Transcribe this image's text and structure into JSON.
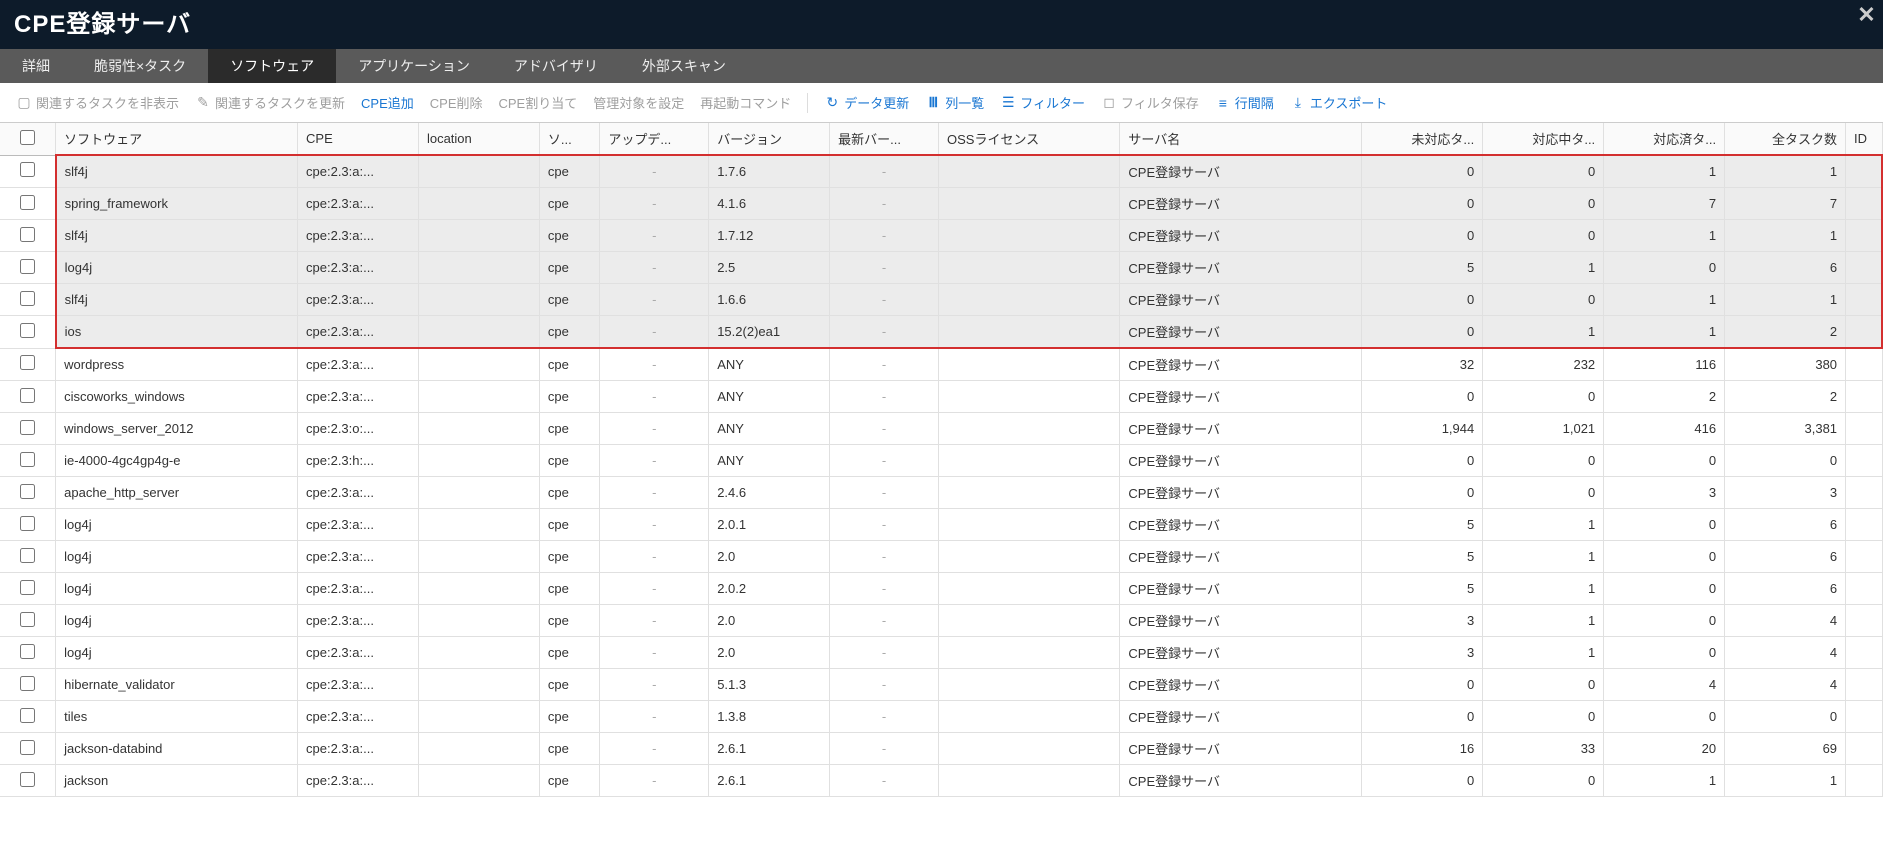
{
  "title": "CPE登録サーバ",
  "tabs": [
    {
      "label": "詳細",
      "active": false
    },
    {
      "label": "脆弱性×タスク",
      "active": false
    },
    {
      "label": "ソフトウェア",
      "active": true
    },
    {
      "label": "アプリケーション",
      "active": false
    },
    {
      "label": "アドバイザリ",
      "active": false
    },
    {
      "label": "外部スキャン",
      "active": false
    }
  ],
  "toolbar": {
    "hide_tasks": "関連するタスクを非表示",
    "update_tasks": "関連するタスクを更新",
    "cpe_add": "CPE追加",
    "cpe_delete": "CPE削除",
    "cpe_assign": "CPE割り当て",
    "set_target": "管理対象を設定",
    "restart_cmd": "再起動コマンド",
    "refresh": "データ更新",
    "columns": "列一覧",
    "filter": "フィルター",
    "save_filter": "フィルタ保存",
    "row_spacing": "行間隔",
    "export": "エクスポート"
  },
  "columns": {
    "software": "ソフトウェア",
    "cpe": "CPE",
    "location": "location",
    "source": "ソ...",
    "update": "アップデ...",
    "version": "バージョン",
    "latest": "最新バー...",
    "oss": "OSSライセンス",
    "server": "サーバ名",
    "unhandled": "未対応タ...",
    "inprogress": "対応中タ...",
    "done": "対応済タ...",
    "total": "全タスク数",
    "id": "ID"
  },
  "rows": [
    {
      "hl": true,
      "software": "slf4j",
      "cpe": "cpe:2.3:a:...",
      "location": "",
      "source": "cpe",
      "update": "-",
      "version": "1.7.6",
      "latest": "-",
      "oss": "",
      "server": "CPE登録サーバ",
      "unhandled": "0",
      "inprogress": "0",
      "done": "1",
      "total": "1"
    },
    {
      "hl": true,
      "software": "spring_framework",
      "cpe": "cpe:2.3:a:...",
      "location": "",
      "source": "cpe",
      "update": "-",
      "version": "4.1.6",
      "latest": "-",
      "oss": "",
      "server": "CPE登録サーバ",
      "unhandled": "0",
      "inprogress": "0",
      "done": "7",
      "total": "7"
    },
    {
      "hl": true,
      "software": "slf4j",
      "cpe": "cpe:2.3:a:...",
      "location": "",
      "source": "cpe",
      "update": "-",
      "version": "1.7.12",
      "latest": "-",
      "oss": "",
      "server": "CPE登録サーバ",
      "unhandled": "0",
      "inprogress": "0",
      "done": "1",
      "total": "1"
    },
    {
      "hl": true,
      "software": "log4j",
      "cpe": "cpe:2.3:a:...",
      "location": "",
      "source": "cpe",
      "update": "-",
      "version": "2.5",
      "latest": "-",
      "oss": "",
      "server": "CPE登録サーバ",
      "unhandled": "5",
      "inprogress": "1",
      "done": "0",
      "total": "6"
    },
    {
      "hl": true,
      "software": "slf4j",
      "cpe": "cpe:2.3:a:...",
      "location": "",
      "source": "cpe",
      "update": "-",
      "version": "1.6.6",
      "latest": "-",
      "oss": "",
      "server": "CPE登録サーバ",
      "unhandled": "0",
      "inprogress": "0",
      "done": "1",
      "total": "1"
    },
    {
      "hl": true,
      "software": "ios",
      "cpe": "cpe:2.3:a:...",
      "location": "",
      "source": "cpe",
      "update": "-",
      "version": "15.2(2)ea1",
      "latest": "-",
      "oss": "",
      "server": "CPE登録サーバ",
      "unhandled": "0",
      "inprogress": "1",
      "done": "1",
      "total": "2"
    },
    {
      "hl": false,
      "software": "wordpress",
      "cpe": "cpe:2.3:a:...",
      "location": "",
      "source": "cpe",
      "update": "-",
      "version": "ANY",
      "latest": "-",
      "oss": "",
      "server": "CPE登録サーバ",
      "unhandled": "32",
      "inprogress": "232",
      "done": "116",
      "total": "380"
    },
    {
      "hl": false,
      "software": "ciscoworks_windows",
      "cpe": "cpe:2.3:a:...",
      "location": "",
      "source": "cpe",
      "update": "-",
      "version": "ANY",
      "latest": "-",
      "oss": "",
      "server": "CPE登録サーバ",
      "unhandled": "0",
      "inprogress": "0",
      "done": "2",
      "total": "2"
    },
    {
      "hl": false,
      "software": "windows_server_2012",
      "cpe": "cpe:2.3:o:...",
      "location": "",
      "source": "cpe",
      "update": "-",
      "version": "ANY",
      "latest": "-",
      "oss": "",
      "server": "CPE登録サーバ",
      "unhandled": "1,944",
      "inprogress": "1,021",
      "done": "416",
      "total": "3,381"
    },
    {
      "hl": false,
      "software": "ie-4000-4gc4gp4g-e",
      "cpe": "cpe:2.3:h:...",
      "location": "",
      "source": "cpe",
      "update": "-",
      "version": "ANY",
      "latest": "-",
      "oss": "",
      "server": "CPE登録サーバ",
      "unhandled": "0",
      "inprogress": "0",
      "done": "0",
      "total": "0"
    },
    {
      "hl": false,
      "software": "apache_http_server",
      "cpe": "cpe:2.3:a:...",
      "location": "",
      "source": "cpe",
      "update": "-",
      "version": "2.4.6",
      "latest": "-",
      "oss": "",
      "server": "CPE登録サーバ",
      "unhandled": "0",
      "inprogress": "0",
      "done": "3",
      "total": "3"
    },
    {
      "hl": false,
      "software": "log4j",
      "cpe": "cpe:2.3:a:...",
      "location": "",
      "source": "cpe",
      "update": "-",
      "version": "2.0.1",
      "latest": "-",
      "oss": "",
      "server": "CPE登録サーバ",
      "unhandled": "5",
      "inprogress": "1",
      "done": "0",
      "total": "6"
    },
    {
      "hl": false,
      "software": "log4j",
      "cpe": "cpe:2.3:a:...",
      "location": "",
      "source": "cpe",
      "update": "-",
      "version": "2.0",
      "latest": "-",
      "oss": "",
      "server": "CPE登録サーバ",
      "unhandled": "5",
      "inprogress": "1",
      "done": "0",
      "total": "6"
    },
    {
      "hl": false,
      "software": "log4j",
      "cpe": "cpe:2.3:a:...",
      "location": "",
      "source": "cpe",
      "update": "-",
      "version": "2.0.2",
      "latest": "-",
      "oss": "",
      "server": "CPE登録サーバ",
      "unhandled": "5",
      "inprogress": "1",
      "done": "0",
      "total": "6"
    },
    {
      "hl": false,
      "software": "log4j",
      "cpe": "cpe:2.3:a:...",
      "location": "",
      "source": "cpe",
      "update": "-",
      "version": "2.0",
      "latest": "-",
      "oss": "",
      "server": "CPE登録サーバ",
      "unhandled": "3",
      "inprogress": "1",
      "done": "0",
      "total": "4"
    },
    {
      "hl": false,
      "software": "log4j",
      "cpe": "cpe:2.3:a:...",
      "location": "",
      "source": "cpe",
      "update": "-",
      "version": "2.0",
      "latest": "-",
      "oss": "",
      "server": "CPE登録サーバ",
      "unhandled": "3",
      "inprogress": "1",
      "done": "0",
      "total": "4"
    },
    {
      "hl": false,
      "software": "hibernate_validator",
      "cpe": "cpe:2.3:a:...",
      "location": "",
      "source": "cpe",
      "update": "-",
      "version": "5.1.3",
      "latest": "-",
      "oss": "",
      "server": "CPE登録サーバ",
      "unhandled": "0",
      "inprogress": "0",
      "done": "4",
      "total": "4"
    },
    {
      "hl": false,
      "software": "tiles",
      "cpe": "cpe:2.3:a:...",
      "location": "",
      "source": "cpe",
      "update": "-",
      "version": "1.3.8",
      "latest": "-",
      "oss": "",
      "server": "CPE登録サーバ",
      "unhandled": "0",
      "inprogress": "0",
      "done": "0",
      "total": "0"
    },
    {
      "hl": false,
      "software": "jackson-databind",
      "cpe": "cpe:2.3:a:...",
      "location": "",
      "source": "cpe",
      "update": "-",
      "version": "2.6.1",
      "latest": "-",
      "oss": "",
      "server": "CPE登録サーバ",
      "unhandled": "16",
      "inprogress": "33",
      "done": "20",
      "total": "69"
    },
    {
      "hl": false,
      "software": "jackson",
      "cpe": "cpe:2.3:a:...",
      "location": "",
      "source": "cpe",
      "update": "-",
      "version": "2.6.1",
      "latest": "-",
      "oss": "",
      "server": "CPE登録サーバ",
      "unhandled": "0",
      "inprogress": "0",
      "done": "1",
      "total": "1"
    }
  ]
}
